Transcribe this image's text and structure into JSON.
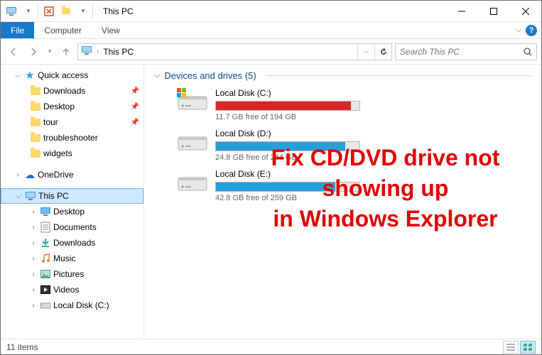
{
  "window": {
    "title": "This PC"
  },
  "tabs": {
    "file": "File",
    "computer": "Computer",
    "view": "View"
  },
  "address": {
    "path": "This PC"
  },
  "search": {
    "placeholder": "Search This PC"
  },
  "sidebar": {
    "quick_access": {
      "label": "Quick access"
    },
    "items": [
      {
        "label": "Downloads",
        "pinned": true
      },
      {
        "label": "Desktop",
        "pinned": true
      },
      {
        "label": "tour",
        "pinned": true
      },
      {
        "label": "troubleshooter"
      },
      {
        "label": "widgets"
      }
    ],
    "onedrive": {
      "label": "OneDrive"
    },
    "this_pc": {
      "label": "This PC"
    },
    "pc_children": [
      {
        "label": "Desktop"
      },
      {
        "label": "Documents"
      },
      {
        "label": "Downloads"
      },
      {
        "label": "Music"
      },
      {
        "label": "Pictures"
      },
      {
        "label": "Videos"
      },
      {
        "label": "Local Disk (C:)"
      }
    ]
  },
  "content": {
    "group_title": "Devices and drives (5)",
    "drives": [
      {
        "name": "Local Disk (C:)",
        "free": "11.7 GB free of 194 GB",
        "fill_pct": 94,
        "color": "red",
        "os": true
      },
      {
        "name": "Local Disk (D:)",
        "free": "24.8 GB free of 244 GB",
        "fill_pct": 90,
        "color": "blue",
        "os": false
      },
      {
        "name": "Local Disk (E:)",
        "free": "42.8 GB free of 259 GB",
        "fill_pct": 83,
        "color": "blue",
        "os": false
      }
    ]
  },
  "overlay": {
    "line1": "Fix CD/DVD drive not showing up",
    "line2": "in Windows Explorer"
  },
  "status": {
    "items": "11 items"
  }
}
